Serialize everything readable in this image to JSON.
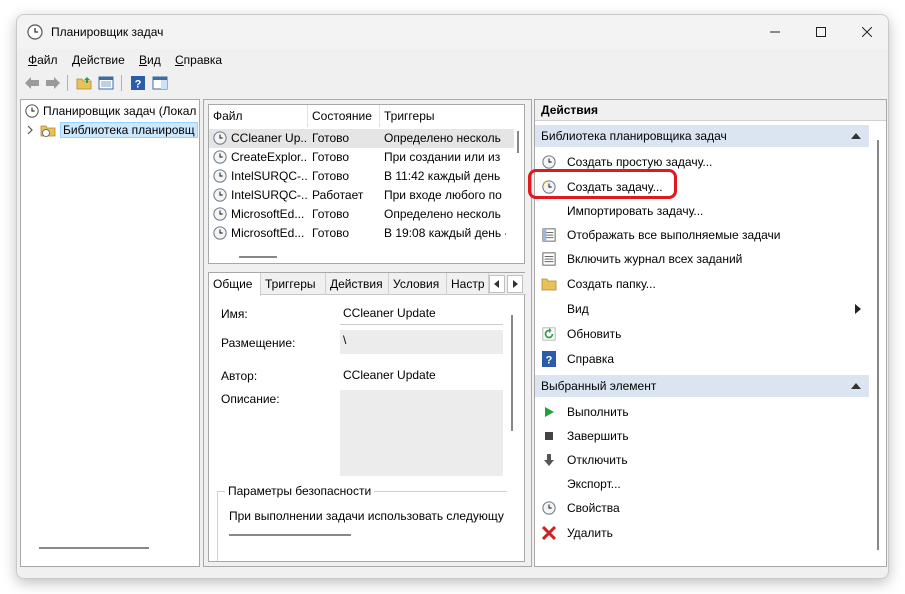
{
  "window": {
    "title": "Планировщик задач"
  },
  "menu": {
    "file": {
      "u": "Ф",
      "rest": "айл"
    },
    "action": {
      "u": "Д",
      "rest": "ействие"
    },
    "view": {
      "u": "В",
      "rest": "ид"
    },
    "help": {
      "u": "С",
      "rest": "правка"
    }
  },
  "tree": {
    "root": "Планировщик задач (Локал",
    "library": "Библиотека планировщ"
  },
  "task_list": {
    "columns": [
      "Файл",
      "Состояние",
      "Триггеры"
    ],
    "rows": [
      {
        "name": "CCleaner Up...",
        "status": "Готово",
        "trigger": "Определено несколь"
      },
      {
        "name": "CreateExplor...",
        "status": "Готово",
        "trigger": "При создании или из"
      },
      {
        "name": "IntelSURQC-...",
        "status": "Готово",
        "trigger": "В 11:42 каждый день"
      },
      {
        "name": "IntelSURQC-...",
        "status": "Работает",
        "trigger": "При входе любого по"
      },
      {
        "name": "MicrosoftEd...",
        "status": "Готово",
        "trigger": "Определено несколь"
      },
      {
        "name": "MicrosoftEd...",
        "status": "Готово",
        "trigger": "В 19:08 каждый день -"
      }
    ]
  },
  "details": {
    "tabs": [
      "Общие",
      "Триггеры",
      "Действия",
      "Условия",
      "Настр"
    ],
    "name_label": "Имя:",
    "name_value": "CCleaner Update",
    "location_label": "Размещение:",
    "location_value": "\\",
    "author_label": "Автор:",
    "author_value": "CCleaner Update",
    "description_label": "Описание:",
    "security_title": "Параметры безопасности",
    "security_text": "При выполнении задачи использовать следующу"
  },
  "actions": {
    "header": "Действия",
    "section1": "Библиотека планировщика задач",
    "items1": [
      "Создать простую задачу...",
      "Создать задачу...",
      "Импортировать задачу...",
      "Отображать все выполняемые задачи",
      "Включить журнал всех заданий",
      "Создать папку...",
      "Вид",
      "Обновить",
      "Справка"
    ],
    "section2": "Выбранный элемент",
    "items2": [
      "Выполнить",
      "Завершить",
      "Отключить",
      "Экспорт...",
      "Свойства",
      "Удалить"
    ]
  },
  "colors": {
    "highlight": "#e0191e",
    "section_bg": "#dbe5f1",
    "selection": "#cce8ff"
  }
}
